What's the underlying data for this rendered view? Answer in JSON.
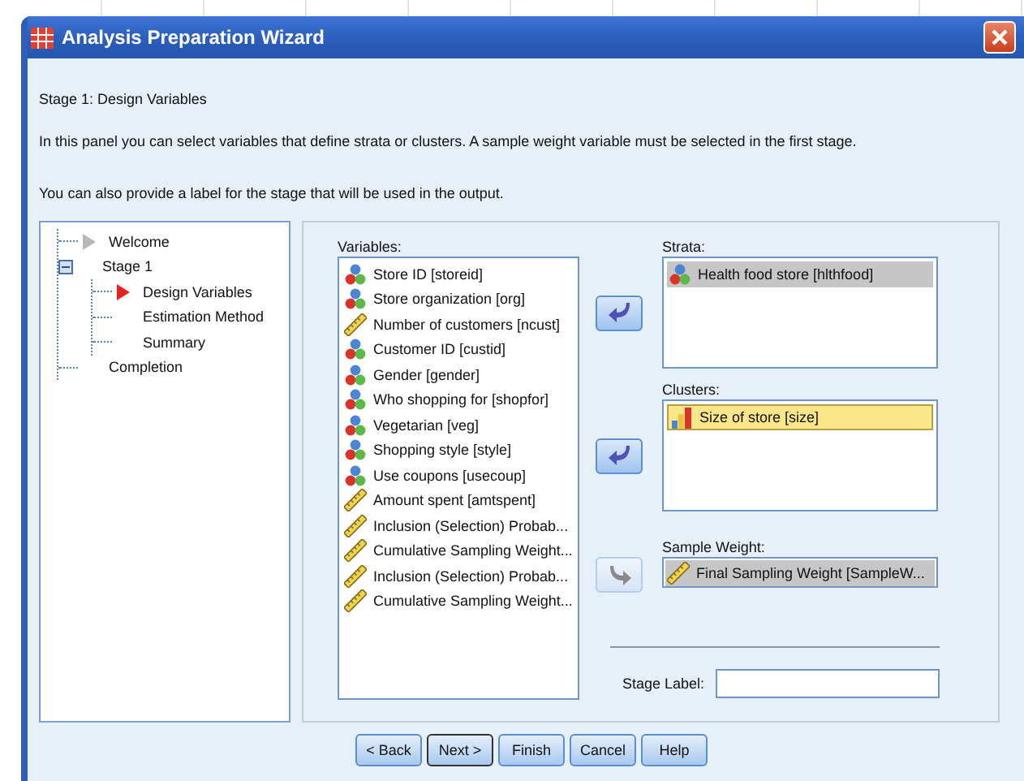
{
  "window": {
    "title": "Analysis Preparation Wizard"
  },
  "stage_heading": "Stage 1: Design Variables",
  "intro": "In this panel you can select variables that define strata or clusters. A sample weight variable must be selected in the first stage.",
  "intro_2": "You can also provide a label for the stage that will be used in the output.",
  "tree": [
    {
      "label": "Welcome",
      "visited": true,
      "current": false
    },
    {
      "label": "Stage 1",
      "visited": false,
      "current": false,
      "expanded": true,
      "children": [
        {
          "label": "Design Variables",
          "visited": false,
          "current": true
        },
        {
          "label": "Estimation Method",
          "visited": false,
          "current": false
        },
        {
          "label": "Summary",
          "visited": false,
          "current": false
        }
      ]
    },
    {
      "label": "Completion",
      "visited": false,
      "current": false
    }
  ],
  "variables": {
    "label": "Variables:",
    "items": [
      {
        "name": "Store ID [storeid]",
        "kind": "nominal"
      },
      {
        "name": "Store organization [org]",
        "kind": "nominal"
      },
      {
        "name": "Number of customers [ncust]",
        "kind": "scale"
      },
      {
        "name": "Customer ID [custid]",
        "kind": "nominal"
      },
      {
        "name": "Gender [gender]",
        "kind": "nominal"
      },
      {
        "name": "Who shopping for [shopfor]",
        "kind": "nominal"
      },
      {
        "name": "Vegetarian [veg]",
        "kind": "nominal"
      },
      {
        "name": "Shopping style [style]",
        "kind": "nominal"
      },
      {
        "name": "Use coupons [usecoup]",
        "kind": "nominal"
      },
      {
        "name": "Amount spent [amtspent]",
        "kind": "scale"
      },
      {
        "name": "Inclusion (Selection) Probab...",
        "kind": "scale"
      },
      {
        "name": "Cumulative Sampling Weight...",
        "kind": "scale"
      },
      {
        "name": "Inclusion (Selection) Probab...",
        "kind": "scale"
      },
      {
        "name": "Cumulative Sampling Weight...",
        "kind": "scale"
      }
    ]
  },
  "targets": [
    {
      "label": "Strata:",
      "single_line": false,
      "arrow": {
        "reversed": false,
        "disabled": false
      },
      "items": [
        {
          "name": "Health food store [hlthfood]",
          "kind": "nominal",
          "selected": true,
          "focused": false
        }
      ]
    },
    {
      "label": "Clusters:",
      "single_line": false,
      "arrow": {
        "reversed": false,
        "disabled": false
      },
      "items": [
        {
          "name": "Size of store [size]",
          "kind": "ordinal",
          "selected": true,
          "focused": true
        }
      ]
    },
    {
      "label": "Sample Weight:",
      "single_line": true,
      "arrow": {
        "reversed": true,
        "disabled": true
      },
      "items": [
        {
          "name": "Final Sampling Weight [SampleW...",
          "kind": "scale",
          "selected": true,
          "focused": false
        }
      ]
    }
  ],
  "stage_label": {
    "label": "Stage Label:"
  },
  "buttons": [
    {
      "label": "< Back",
      "default": false
    },
    {
      "label": "Next >",
      "default": true
    },
    {
      "label": "Finish",
      "default": false
    },
    {
      "label": "Cancel",
      "default": false
    },
    {
      "label": "Help",
      "default": false
    }
  ]
}
